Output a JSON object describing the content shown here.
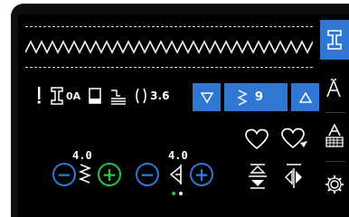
{
  "stitch_preview": {
    "pattern": "zigzag-stitch-preview"
  },
  "toolbar": {
    "foot_label": "0A",
    "tension_value": "3.6"
  },
  "stitch_selector": {
    "value": "9",
    "decrease_icon": "triangle-down-icon",
    "increase_icon": "triangle-up-icon"
  },
  "length_adjust": {
    "value": "4.0",
    "minus": "−",
    "plus": "+"
  },
  "width_adjust": {
    "value": "4.0",
    "minus": "−",
    "plus": "+"
  },
  "pager": {
    "current": 1,
    "total": 2
  },
  "side_tabs": [
    "stitch-foot-icon",
    "font-a-icon",
    "font-a-keyboard-icon",
    "settings-gear-icon"
  ],
  "colors": {
    "accent": "#2f77d2",
    "plus_green": "#27c24c",
    "pager_active": "#27c24c",
    "pager_inactive": "#ffffff",
    "background": "#000000"
  }
}
